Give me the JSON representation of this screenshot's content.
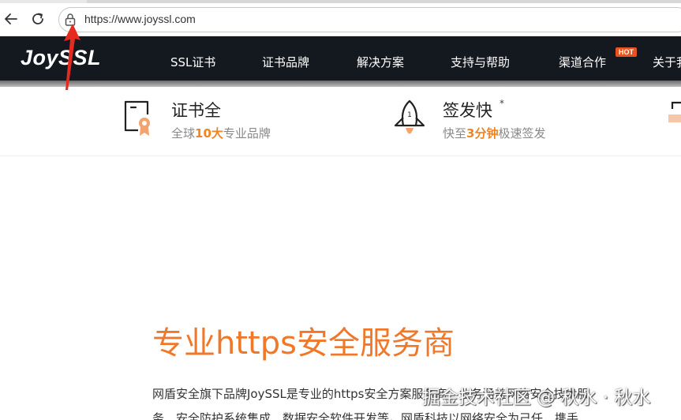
{
  "browser": {
    "url": "https://www.joyssl.com"
  },
  "site": {
    "logo": "JoySSL",
    "nav": [
      {
        "label": "SSL证书"
      },
      {
        "label": "证书品牌"
      },
      {
        "label": "解决方案"
      },
      {
        "label": "支持与帮助"
      },
      {
        "label": "渠道合作"
      },
      {
        "label": "关于我"
      }
    ],
    "hot_badge": "HOT"
  },
  "features": [
    {
      "title": "证书全",
      "sub_pre": "全球",
      "sub_hl": "10大",
      "sub_post": "专业品牌",
      "icon": "certificate-icon"
    },
    {
      "title": "签发快",
      "sup": "*",
      "sub_pre": "快至",
      "sub_hl": "3分钟",
      "sub_post": "极速签发",
      "icon": "rocket-icon"
    }
  ],
  "main": {
    "title": "专业https安全服务商",
    "line1": "网盾安全旗下品牌JoySSL是专业的https安全方案服务商，业务涵盖网络安全技术服",
    "line2": "务、安全防护系统集成、数据安全软件开发等。网盾科技以网络安全为己任，携手"
  },
  "watermark": "掘金技术社区 @ 秋水 · 秋水",
  "colors": {
    "accent": "#f0782a",
    "header_bg": "#14181f",
    "arrow": "#e52b1f"
  }
}
